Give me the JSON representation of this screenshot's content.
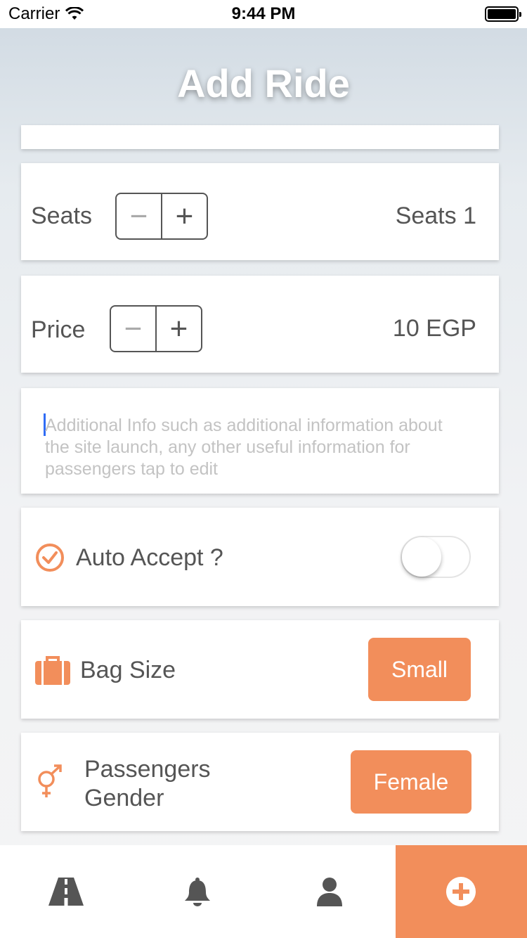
{
  "status_bar": {
    "carrier": "Carrier",
    "time": "9:44 PM"
  },
  "header": {
    "title": "Add Ride"
  },
  "seats": {
    "label": "Seats",
    "minus": "−",
    "plus": "+",
    "value": "Seats 1"
  },
  "price": {
    "label": "Price",
    "minus": "−",
    "plus": "+",
    "value": "10 EGP"
  },
  "additional_info": {
    "placeholder": "Additional Info such as additional information about the site launch, any other useful information for passengers  tap to edit"
  },
  "auto_accept": {
    "label": "Auto Accept ?",
    "enabled": false,
    "icon": "check-circle-icon"
  },
  "bag_size": {
    "label": "Bag Size",
    "value": "Small",
    "icon": "suitcase-icon"
  },
  "passengers_gender": {
    "label_line1": "Passengers",
    "label_line2": "Gender",
    "value": "Female",
    "icon": "gender-icon"
  },
  "tabbar": {
    "tabs": [
      {
        "icon": "road-icon",
        "active": false
      },
      {
        "icon": "bell-icon",
        "active": false
      },
      {
        "icon": "user-icon",
        "active": false
      },
      {
        "icon": "plus-circle-icon",
        "active": true
      }
    ]
  },
  "colors": {
    "accent": "#f28e5b",
    "text": "#555555",
    "placeholder": "#c3c3c3",
    "caret": "#2f6cf5"
  }
}
